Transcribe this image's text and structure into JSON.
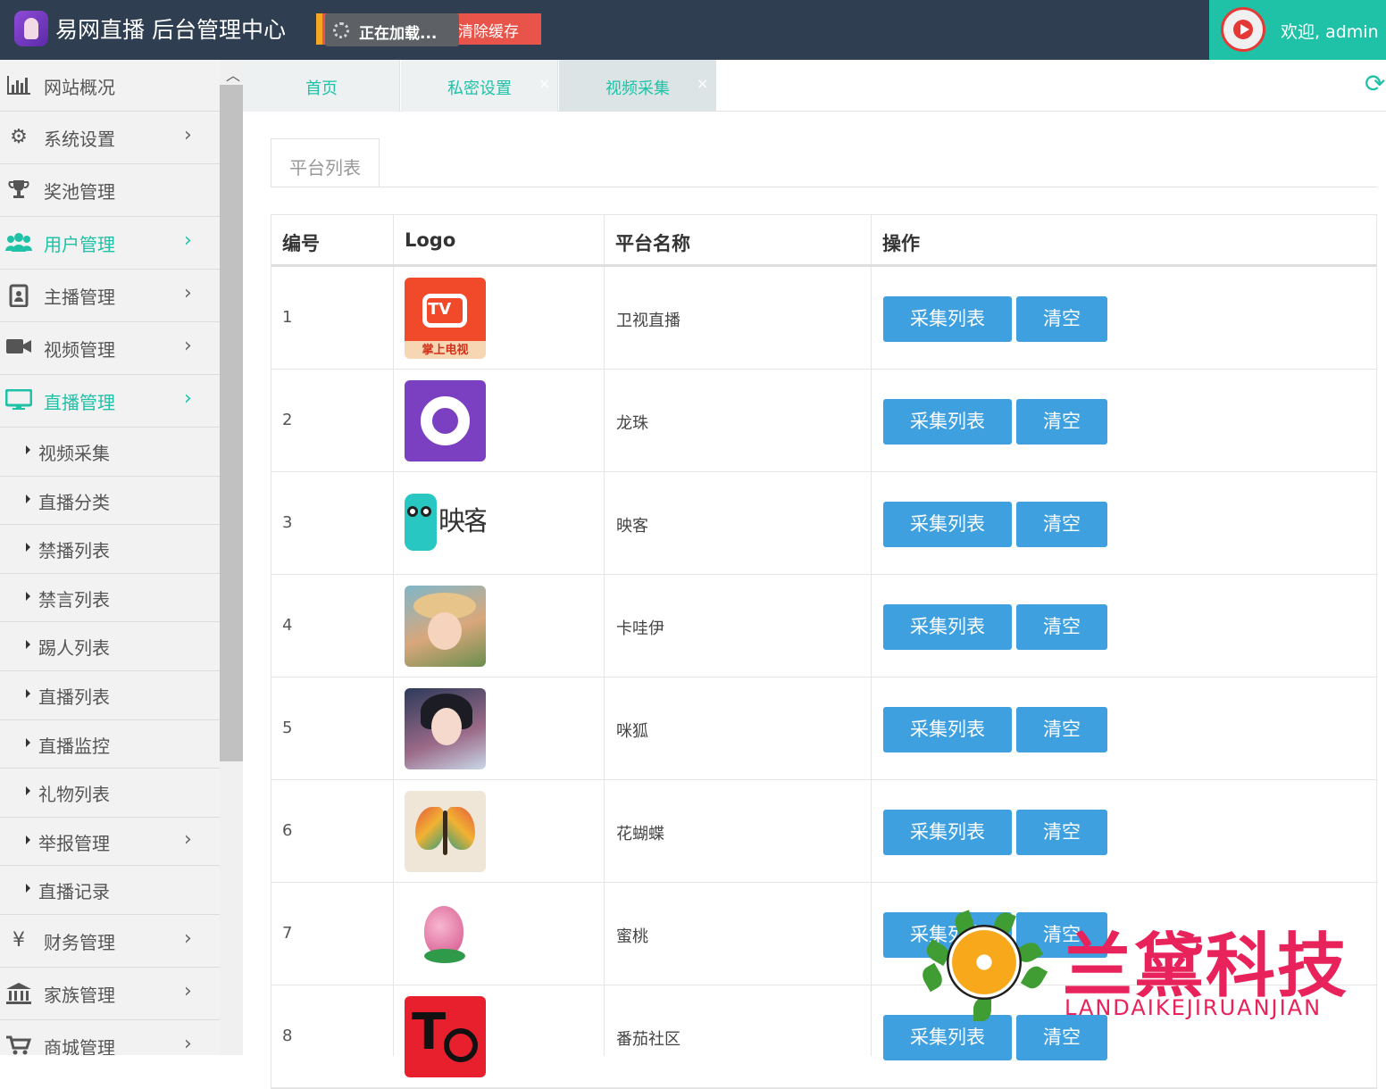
{
  "header": {
    "app_title": "易网直播 后台管理中心",
    "clear_cache_label": "清除缓存",
    "loading_label": "正在加载...",
    "welcome_label": "欢迎, admin"
  },
  "sidebar": {
    "items": [
      {
        "label": "网站概况",
        "icon": "bar-chart-icon"
      },
      {
        "label": "系统设置",
        "icon": "gears-icon"
      },
      {
        "label": "奖池管理",
        "icon": "trophy-icon"
      },
      {
        "label": "用户管理",
        "icon": "users-icon"
      },
      {
        "label": "主播管理",
        "icon": "id-badge-icon"
      },
      {
        "label": "视频管理",
        "icon": "video-camera-icon"
      },
      {
        "label": "直播管理",
        "icon": "desktop-icon"
      }
    ],
    "live_sub_items": [
      "视频采集",
      "直播分类",
      "禁播列表",
      "禁言列表",
      "踢人列表",
      "直播列表",
      "直播监控",
      "礼物列表",
      "举报管理",
      "直播记录"
    ],
    "bottom_items": [
      {
        "label": "财务管理",
        "icon": "yen-icon"
      },
      {
        "label": "家族管理",
        "icon": "bank-icon"
      },
      {
        "label": "商城管理",
        "icon": "cart-icon"
      }
    ]
  },
  "tabs": [
    {
      "label": "首页"
    },
    {
      "label": "私密设置",
      "close": "×"
    },
    {
      "label": "视频采集",
      "close": "×"
    }
  ],
  "content": {
    "section_tab": "平台列表",
    "columns": [
      "编号",
      "Logo",
      "平台名称",
      "操作"
    ],
    "collect_label": "采集列表",
    "clear_label": "清空",
    "rows": [
      {
        "no": "1",
        "name": "卫视直播",
        "logo": "tv-logo"
      },
      {
        "no": "2",
        "name": "龙珠",
        "logo": "longzhu-logo"
      },
      {
        "no": "3",
        "name": "映客",
        "logo": "yingke-logo"
      },
      {
        "no": "4",
        "name": "卡哇伊",
        "logo": "kawayi-logo"
      },
      {
        "no": "5",
        "name": "咪狐",
        "logo": "mihu-logo"
      },
      {
        "no": "6",
        "name": "花蝴蝶",
        "logo": "butterfly-logo"
      },
      {
        "no": "7",
        "name": "蜜桃",
        "logo": "peach-logo"
      },
      {
        "no": "8",
        "name": "番茄社区",
        "logo": "fanqie-logo"
      }
    ],
    "logo_texts": {
      "tv": "TV",
      "tv_caption": "掌上电视",
      "yingke": "映客",
      "fanqie": "T"
    }
  },
  "watermark": {
    "title": "兰黛科技",
    "subtitle": "LANDAIKEJIRUANJIAN"
  },
  "colors": {
    "header_bg": "#2f3e50",
    "accent": "#1fc2a7",
    "button": "#3fa0e0",
    "danger": "#e8534a",
    "watermark": "#e8225a"
  }
}
